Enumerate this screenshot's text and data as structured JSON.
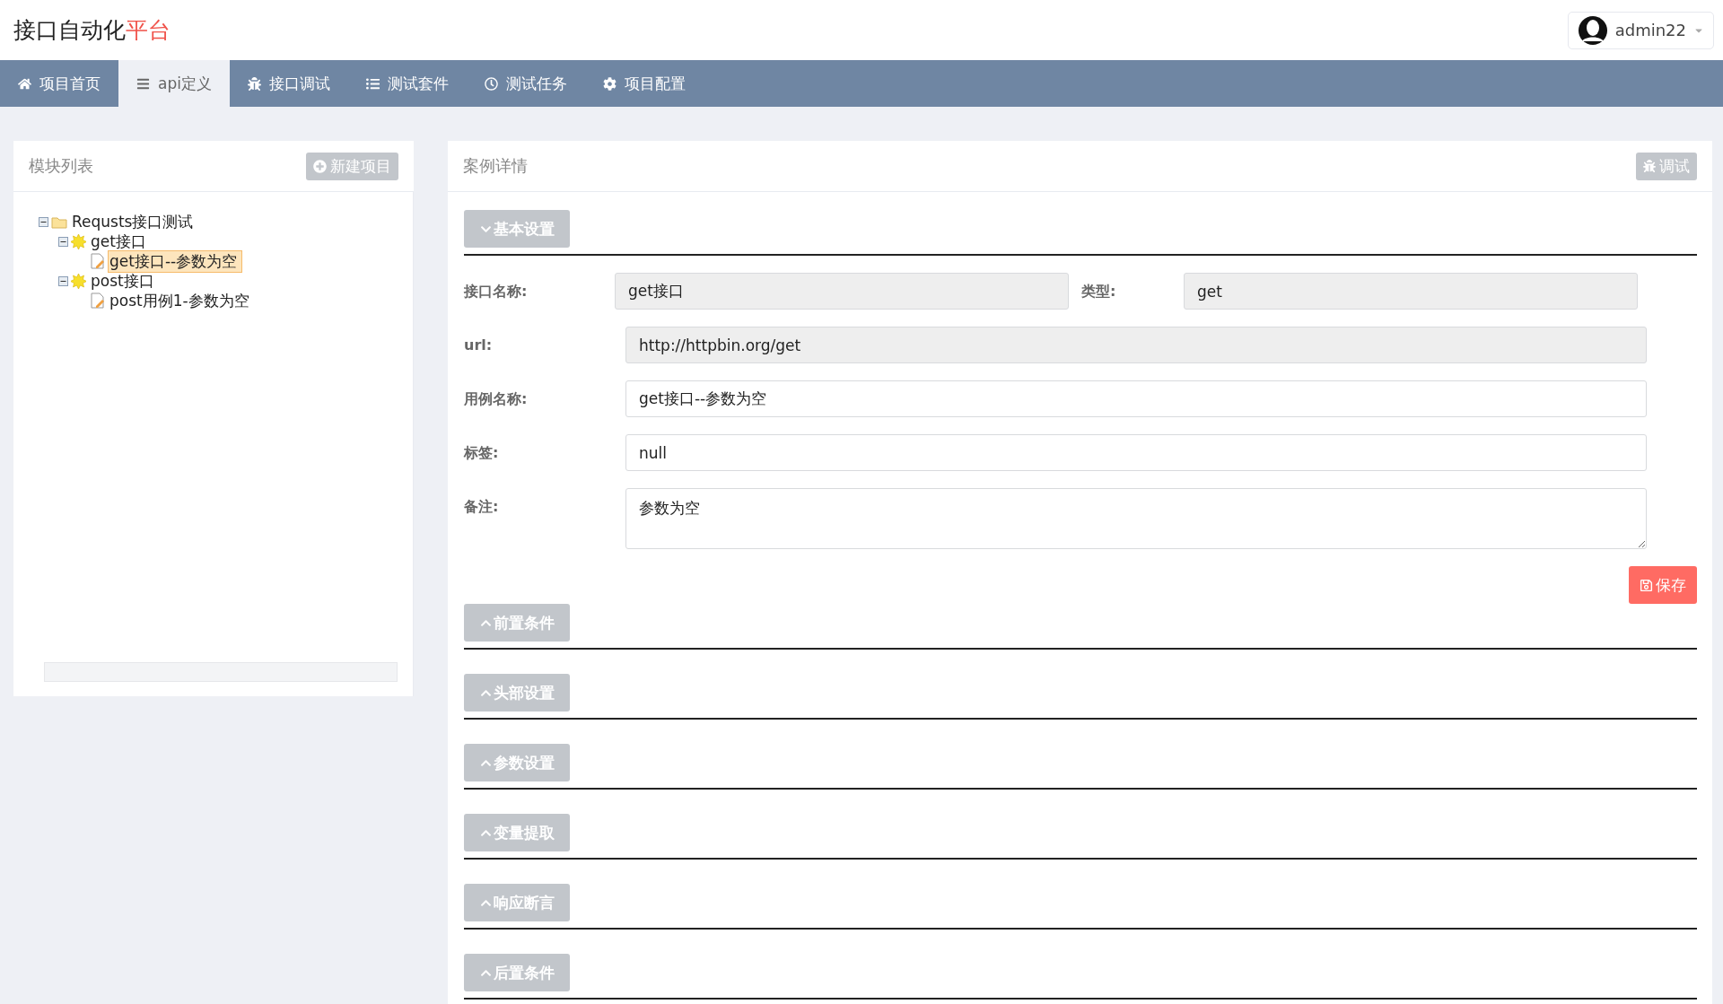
{
  "header": {
    "title": "接口自动化**平台**",
    "user": "admin22"
  },
  "nav": [
    {
      "label": "项目首页",
      "selected": false
    },
    {
      "label": "api定义",
      "selected": true
    },
    {
      "label": "接口调试",
      "selected": false
    },
    {
      "label": "测试套件",
      "selected": false
    },
    {
      "label": "测试任务",
      "selected": false
    },
    {
      "label": "项目配置",
      "selected": false
    }
  ],
  "module_panel": {
    "title": "模块列表",
    "new_button": "新建项目",
    "tree": [
      {
        "label": "Requsts接口测试",
        "kind": "folder",
        "expanded": true,
        "selected": false,
        "children": [
          {
            "label": "get接口",
            "kind": "module",
            "expanded": true,
            "selected": false,
            "children": [
              {
                "label": "get接口--参数为空",
                "kind": "case",
                "selected": true
              }
            ]
          },
          {
            "label": "post接口",
            "kind": "module",
            "expanded": true,
            "selected": false,
            "children": [
              {
                "label": "post用例1-参数为空",
                "kind": "case",
                "selected": false
              }
            ]
          }
        ]
      }
    ]
  },
  "detail_panel": {
    "title": "案例详情",
    "debug_button": "调试",
    "sections": [
      {
        "label": "基本设置",
        "expanded": true
      },
      {
        "label": "前置条件",
        "expanded": false
      },
      {
        "label": "头部设置",
        "expanded": false
      },
      {
        "label": "参数设置",
        "expanded": false
      },
      {
        "label": "变量提取",
        "expanded": false
      },
      {
        "label": "响应断言",
        "expanded": false
      },
      {
        "label": "后置条件",
        "expanded": false
      }
    ],
    "form_rows": [
      {
        "fields": [
          {
            "label": "接口名称:",
            "value": "get接口",
            "disabled": true,
            "kind": "input"
          },
          {
            "label": "类型:",
            "value": "get",
            "disabled": true,
            "kind": "input"
          }
        ]
      },
      {
        "fields": [
          {
            "label": "url:",
            "value": "http://httpbin.org/get",
            "disabled": true,
            "kind": "input"
          }
        ]
      },
      {
        "fields": [
          {
            "label": "用例名称:",
            "value": "get接口--参数为空",
            "disabled": false,
            "kind": "input"
          }
        ]
      },
      {
        "fields": [
          {
            "label": "标签:",
            "value": "null",
            "disabled": false,
            "kind": "input"
          }
        ]
      },
      {
        "fields": [
          {
            "label": "备注:",
            "value": "参数为空",
            "disabled": false,
            "kind": "textarea"
          }
        ]
      }
    ],
    "save_button": "保存"
  }
}
